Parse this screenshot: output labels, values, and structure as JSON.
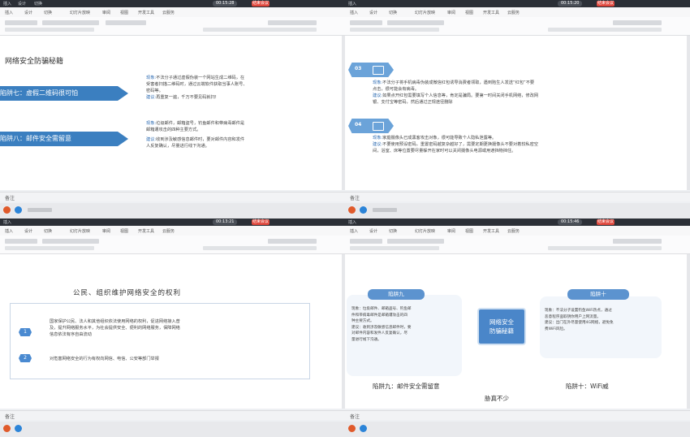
{
  "common": {
    "menu": [
      "插入",
      "设计",
      "切换",
      "幻灯片放映",
      "审阅",
      "视图",
      "开发工具",
      "云服务"
    ],
    "notes_label": "备注",
    "end_button": "结束会议"
  },
  "tl": {
    "time": "00:15:28",
    "title": "网络安全防骗秘籍",
    "trap7": "陷阱七：虚假二维码很可怕",
    "trap8": "陷阱八：邮件安全需留意",
    "t7_line1_key": "现象:",
    "t7_line1": "不法分子通过虚假伪装一个网站生成二维码，在",
    "t7_line2": "受害者扫描二维码时，通过云端软件获取当事人账号、",
    "t7_line3": "密码等。",
    "t7_tip_key": "建议:",
    "t7_tip": "再重复一遍，千万不要见码就扫!",
    "t8_line1_key": "现象:",
    "t8_line1": "垃圾邮件，邮箱盗号，钓鱼邮件和带病毒邮件是",
    "t8_line2": "邮箱遭攻击的四种主要方式。",
    "t8_tip_key": "建议:",
    "t8_tip1": "收到涉及敏感信息邮件时，要对邮件内容和发件",
    "t8_tip2": "人反复确认，尽量进行线下沟通。"
  },
  "tr": {
    "time": "00:15:20",
    "badge3": "03",
    "badge4": "04",
    "p3_key": "现象:",
    "p3_line1": "不法分子将手机病毒伪装成微信红包诱导消费者领取，遇到陷生人发送“红包”不要",
    "p3_line2": "点击，很可能会有病毒。",
    "p3_tip_key": "建议:",
    "p3_tip1": "如果点开红包需要填写个人信息等，肯定是骗局。要第一时间关闭手机网络，修改网",
    "p3_tip2": "银、支付宝等密码，然后通过正规途径删除",
    "p4_key": "现象:",
    "p4_line1": "家庭摄像头已成黑客攻击对象，很可能导致个人隐私泄露等。",
    "p4_tip_key": "建议:",
    "p4_tip1": "不要使用预设密码，重置密码越复杂越好了，需要定期更换摄像头不要对着较私密空",
    "p4_tip2": "间，浴室、床等位置要尽量躲开在家时可以关闭摄像头电源或用遮挡物挡住。"
  },
  "bl": {
    "time": "00:13:21",
    "title": "公民、组织维护网络安全的权利",
    "num1": "1",
    "num2": "2",
    "r1_line1": "国家保护公民、法人和其他组织依法使用网络的权利，促进网络接入普",
    "r1_line2": "及，提升网络服务水平，为社会提供安全、便利的网络服务，保障网络",
    "r1_line3": "信息依法有序自由流动",
    "r2": "对危害网络安全的行为有权向网信、电信、公安等部门举报"
  },
  "br": {
    "time": "00:15:46",
    "trap9_title": "陷阱九",
    "trap10_title": "陷阱十",
    "center1": "网络安全",
    "center2": "防骗秘籍",
    "t9_lines": [
      "现象：垃圾邮件、邮箱盗号、钓鱼邮",
      "件和带病毒邮件是邮箱遭攻击的四",
      "种主要方式。",
      "建议：收到涉及敏感信息邮件时，要",
      "对邮件内容和发件人反复确认，尽",
      "量进行线下沟通。"
    ],
    "t10_lines": [
      "现象：不法分子设置钓鱼WiFi热点，通过",
      "恶意程序盗取钥你用户上网流量。",
      "建议：出门在外尽量使用4G网络，避免免",
      "费WiFi风险。"
    ],
    "cap9": "陷阱九：邮件安全需留意",
    "cap10": "陷阱十：WiFi威",
    "cap_mid": "胁真不少"
  }
}
